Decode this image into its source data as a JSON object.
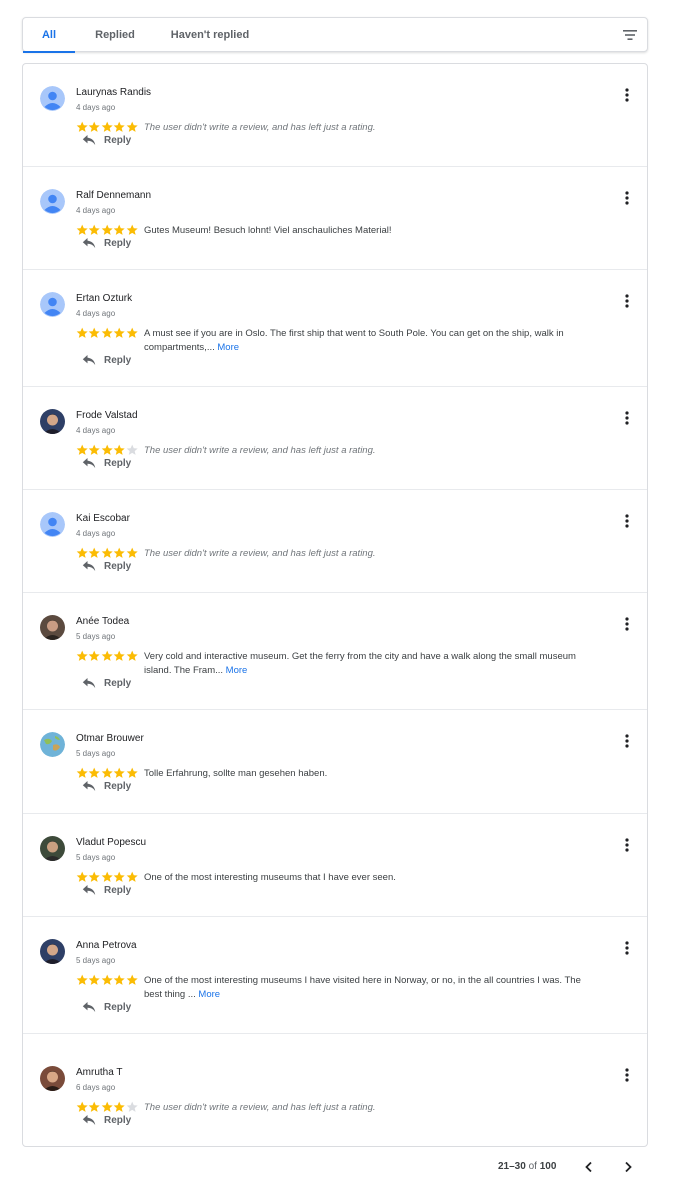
{
  "tabs": [
    {
      "label": "All",
      "selected": true
    },
    {
      "label": "Replied",
      "selected": false
    },
    {
      "label": "Haven't replied",
      "selected": false
    }
  ],
  "sort_icon": "sort-icon",
  "reply_label": "Reply",
  "more_label": "More",
  "colors": {
    "accent": "#1a73e8",
    "star": "#fbbc04",
    "star_empty": "#dadce0",
    "avatar_default": "#4285f4"
  },
  "reviews": [
    {
      "name": "Laurynas Randis",
      "date": "4 days ago",
      "stars": 5,
      "text": "The user didn't write a review, and has left just a rating.",
      "rating_only": true,
      "avatar": "default"
    },
    {
      "name": "Ralf Dennemann",
      "date": "4 days ago",
      "stars": 5,
      "text": "Gutes Museum! Besuch lohnt! Viel anschauliches Material!",
      "rating_only": false,
      "avatar": "default"
    },
    {
      "name": "Ertan Ozturk",
      "date": "4 days ago",
      "stars": 5,
      "text": "A must see if you are in Oslo. The first ship that went to South Pole. You can get on the ship, walk in compartments,...",
      "rating_only": false,
      "has_more": true,
      "avatar": "default"
    },
    {
      "name": "Frode Valstad",
      "date": "4 days ago",
      "stars": 4,
      "text": "The user didn't write a review, and has left just a rating.",
      "rating_only": true,
      "avatar": "photo"
    },
    {
      "name": "Kai Escobar",
      "date": "4 days ago",
      "stars": 5,
      "text": "The user didn't write a review, and has left just a rating.",
      "rating_only": true,
      "avatar": "default"
    },
    {
      "name": "Anée Todea",
      "date": "5 days ago",
      "stars": 5,
      "text": "Very cold and interactive museum. Get the ferry from the city and have a walk along the small museum island. The Fram...",
      "rating_only": false,
      "has_more": true,
      "avatar": "photo"
    },
    {
      "name": "Otmar Brouwer",
      "date": "5 days ago",
      "stars": 5,
      "text": "Tolle Erfahrung, sollte man gesehen haben.",
      "rating_only": false,
      "avatar": "globe"
    },
    {
      "name": "Vladut Popescu",
      "date": "5 days ago",
      "stars": 5,
      "text": "One of the most interesting museums that I have ever seen.",
      "rating_only": false,
      "avatar": "photo"
    },
    {
      "name": "Anna Petrova",
      "date": "5 days ago",
      "stars": 5,
      "text": "One of the most interesting museums I have visited here in Norway, or no, in the all countries I was. The best thing ...",
      "rating_only": false,
      "has_more": true,
      "avatar": "photo"
    },
    {
      "name": "Amrutha T",
      "date": "6 days ago",
      "stars": 4,
      "text": "The user didn't write a review, and has left just a rating.",
      "rating_only": true,
      "avatar": "photo"
    }
  ],
  "pagination": {
    "range": "21–30",
    "of_label": "of",
    "total": "100"
  }
}
